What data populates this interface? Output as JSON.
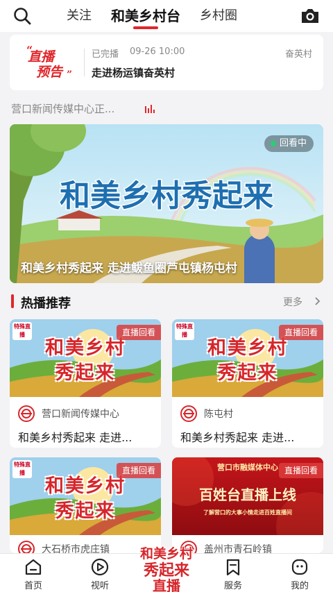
{
  "top_nav": {
    "tabs": [
      "关注",
      "和美乡村台",
      "乡村圈"
    ],
    "active_tab": 1,
    "accent_color": "#e0262b"
  },
  "live_preview": {
    "logo_text_1": "直播",
    "logo_text_2": "预告",
    "status": "已完播",
    "time": "09-26 10:00",
    "village": "奋英村",
    "title": "走进杨运镇奋英村"
  },
  "ticker": {
    "text": "营口新闻传媒中心正..."
  },
  "banner": {
    "art_title": "和美乡村秀起来",
    "badge": "回看中",
    "caption": "和美乡村秀起来 走进鲅鱼圈芦屯镇杨屯村"
  },
  "section": {
    "title": "热播推荐",
    "more": "更多"
  },
  "cards": [
    {
      "thumb_line1": "和美乡村",
      "thumb_line2": "秀起来",
      "mini_logo": "特殊直播",
      "tag": "直播回看",
      "publisher": "营口新闻传媒中心",
      "title": "和美乡村秀起来 走进..."
    },
    {
      "thumb_line1": "和美乡村",
      "thumb_line2": "秀起来",
      "mini_logo": "特殊直播",
      "tag": "直播回看",
      "publisher": "陈屯村",
      "title": "和美乡村秀起来 走进..."
    },
    {
      "thumb_line1": "和美乡村",
      "thumb_line2": "秀起来",
      "mini_logo": "特殊直播",
      "tag": "直播回看",
      "publisher": "大石桥市虎庄镇",
      "title": ""
    },
    {
      "thumb_top": "营口市融媒体中心",
      "thumb_main": "百姓台直播上线",
      "thumb_sub": "了解营口的大事小情走进百姓直播间",
      "tag": "直播回看",
      "publisher": "盖州市青石岭镇",
      "title": ""
    }
  ],
  "bottom_nav": {
    "items": [
      "首页",
      "视听",
      "服务",
      "我的"
    ],
    "center_line1": "和美乡村",
    "center_line2": "秀起来",
    "center_line3": "直播"
  }
}
